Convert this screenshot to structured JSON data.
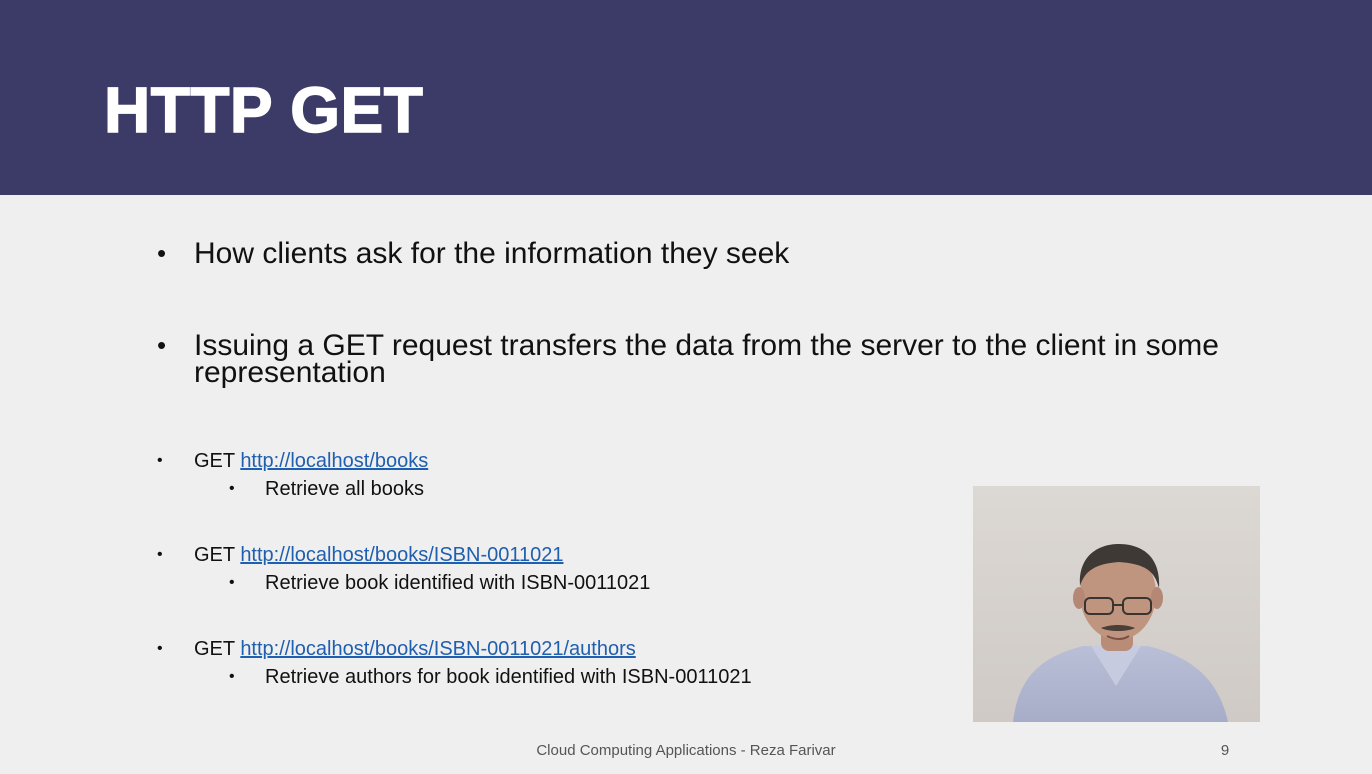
{
  "slide": {
    "title": "HTTP GET",
    "bullets": [
      "How clients ask for the information they seek",
      "Issuing a GET request transfers the data from the server to the client in some representation"
    ],
    "examples": [
      {
        "method": "GET ",
        "url": "http://localhost/books",
        "description": "Retrieve all books"
      },
      {
        "method": "GET ",
        "url": "http://localhost/books/ISBN-0011021",
        "description": "Retrieve book identified with ISBN-0011021"
      },
      {
        "method": "GET ",
        "url": "http://localhost/books/ISBN-0011021/authors",
        "description": "Retrieve authors for book identified with ISBN-0011021"
      }
    ],
    "footer": "Cloud Computing Applications - Reza Farivar",
    "page_number": "9"
  },
  "colors": {
    "title_bar": "#3c3a67",
    "background": "#f0efef",
    "link": "#1f5fb0"
  }
}
